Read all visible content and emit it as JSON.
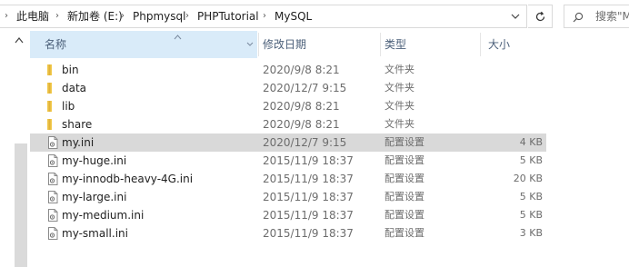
{
  "address_bar": {
    "crumbs": [
      "此电脑",
      "新加卷 (E:)",
      "Phpmysql",
      "PHPTutorial",
      "MySQL"
    ]
  },
  "search": {
    "placeholder": "搜索\"M"
  },
  "columns": {
    "name": "名称",
    "date": "修改日期",
    "type": "类型",
    "size": "大小"
  },
  "files": [
    {
      "name": "bin",
      "date": "2020/9/8 8:21",
      "type": "文件夹",
      "size": "",
      "icon": "folder-icon",
      "selected": false
    },
    {
      "name": "data",
      "date": "2020/12/7 9:15",
      "type": "文件夹",
      "size": "",
      "icon": "folder-icon",
      "selected": false
    },
    {
      "name": "lib",
      "date": "2020/9/8 8:21",
      "type": "文件夹",
      "size": "",
      "icon": "folder-icon",
      "selected": false
    },
    {
      "name": "share",
      "date": "2020/9/8 8:21",
      "type": "文件夹",
      "size": "",
      "icon": "folder-icon",
      "selected": false
    },
    {
      "name": "my.ini",
      "date": "2020/12/7 9:15",
      "type": "配置设置",
      "size": "4 KB",
      "icon": "config-file-icon",
      "selected": true
    },
    {
      "name": "my-huge.ini",
      "date": "2015/11/9 18:37",
      "type": "配置设置",
      "size": "5 KB",
      "icon": "config-file-icon",
      "selected": false
    },
    {
      "name": "my-innodb-heavy-4G.ini",
      "date": "2015/11/9 18:37",
      "type": "配置设置",
      "size": "20 KB",
      "icon": "config-file-icon",
      "selected": false
    },
    {
      "name": "my-large.ini",
      "date": "2015/11/9 18:37",
      "type": "配置设置",
      "size": "5 KB",
      "icon": "config-file-icon",
      "selected": false
    },
    {
      "name": "my-medium.ini",
      "date": "2015/11/9 18:37",
      "type": "配置设置",
      "size": "5 KB",
      "icon": "config-file-icon",
      "selected": false
    },
    {
      "name": "my-small.ini",
      "date": "2015/11/9 18:37",
      "type": "配置设置",
      "size": "3 KB",
      "icon": "config-file-icon",
      "selected": false
    }
  ],
  "colors": {
    "folder": "#f2c94c",
    "header_highlight": "#d9ebf9",
    "selected_row": "#d9d9d9"
  }
}
